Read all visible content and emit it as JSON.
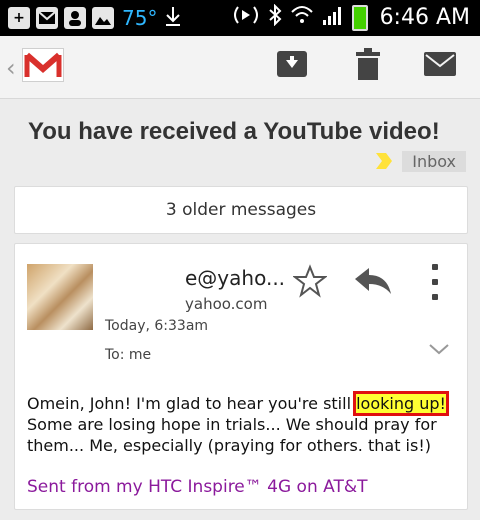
{
  "status_bar": {
    "temperature": "75°",
    "time": "6:46 AM",
    "icons": [
      "plus-icon",
      "mail-icon",
      "account-icon",
      "image-icon",
      "download-icon",
      "nfc-icon",
      "bluetooth-icon",
      "wifi-icon",
      "signal-icon",
      "battery-icon"
    ]
  },
  "action_bar": {
    "app": "Gmail",
    "actions": [
      "archive-icon",
      "trash-icon",
      "mark-unread-icon"
    ]
  },
  "conversation": {
    "subject": "You have received a YouTube video!",
    "label": "Inbox",
    "label_color": "#ffe23a",
    "older_messages": "3 older messages"
  },
  "message": {
    "sender_display": "e@yaho...",
    "sender_email": "yahoo.com",
    "date": "Today, 6:33am",
    "to": "To: me",
    "body_before": "Omein, John! I'm glad to hear you're still ",
    "body_highlight": "looking up!",
    "body_after": " Some are losing hope in trials... We should pray for them... Me, especially (praying for others. that is!)",
    "signature": "Sent from my HTC Inspire™ 4G on AT&T",
    "highlight_color": "#ffff33",
    "highlight_border_color": "#e01010"
  }
}
